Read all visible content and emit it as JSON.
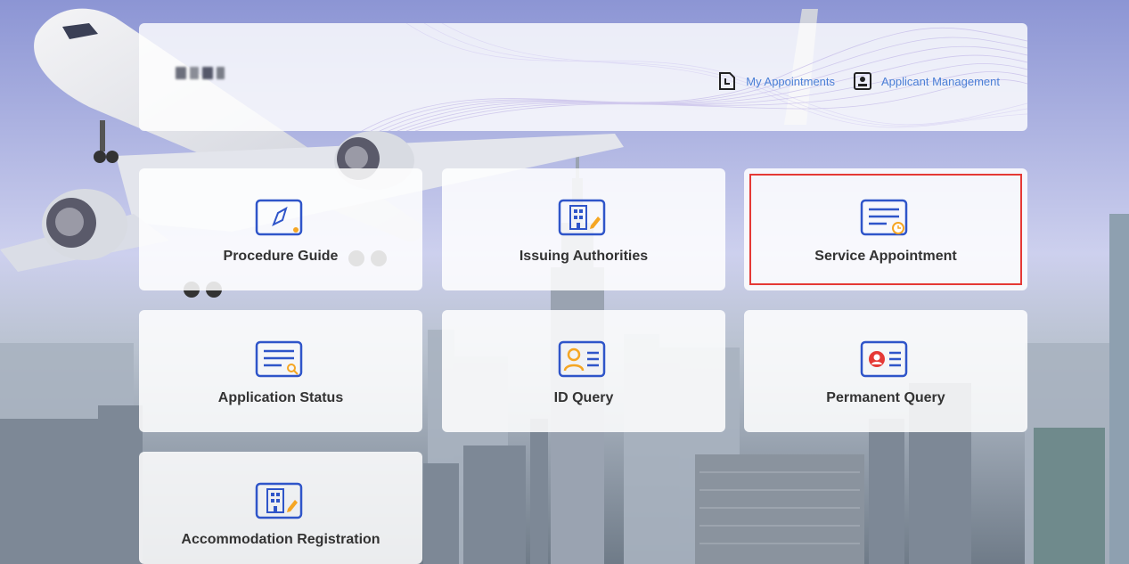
{
  "header": {
    "logo_alt": "blurred logo",
    "links": [
      {
        "label": "My Appointments",
        "icon": "appointment-doc-icon"
      },
      {
        "label": "Applicant Management",
        "icon": "id-card-icon"
      }
    ]
  },
  "tiles": [
    {
      "label": "Procedure Guide",
      "icon": "compass-icon",
      "selected": false
    },
    {
      "label": "Issuing Authorities",
      "icon": "building-icon",
      "selected": false
    },
    {
      "label": "Service Appointment",
      "icon": "appointment-clock-icon",
      "selected": true
    },
    {
      "label": "Application Status",
      "icon": "document-search-icon",
      "selected": false
    },
    {
      "label": "ID Query",
      "icon": "person-card-icon",
      "selected": false
    },
    {
      "label": "Permanent Query",
      "icon": "permanent-card-icon",
      "selected": false
    },
    {
      "label": "Accommodation Registration",
      "icon": "building-icon",
      "selected": false
    }
  ],
  "colors": {
    "icon_blue": "#2f55c9",
    "icon_yellow": "#f5a623",
    "icon_red": "#e53935",
    "link_blue": "#4a7fd6",
    "selection_red": "#e53935"
  }
}
